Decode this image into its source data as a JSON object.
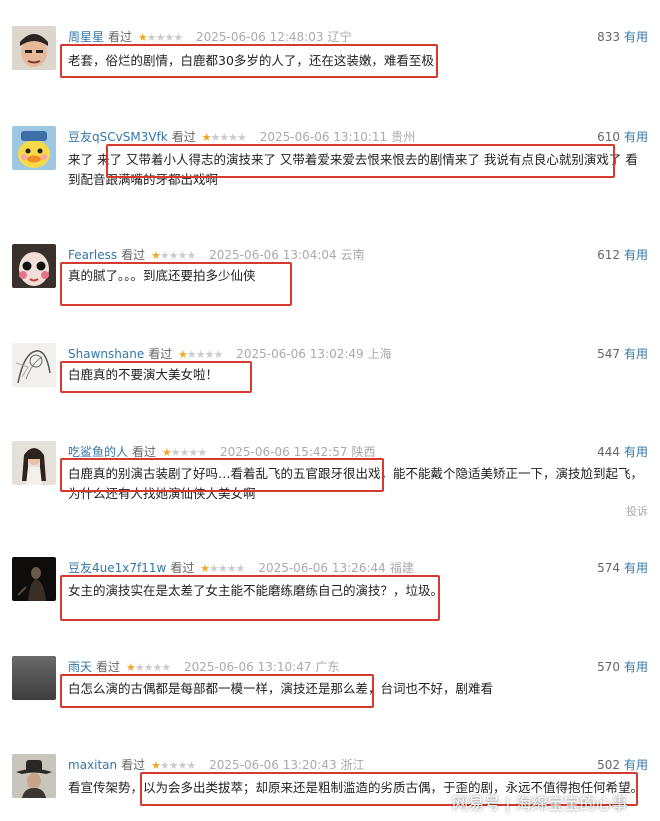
{
  "watched_label": "看过",
  "useful_label": "有用",
  "report_label": "投诉",
  "watermark": "网易号 | 海绵宝宝的心事",
  "reviews": [
    {
      "user": "周星星",
      "stars": 1,
      "date": "2025-06-06 12:48:03",
      "location": "辽宁",
      "votes": "833",
      "text": "老套，俗烂的剧情，白鹿都30多岁的人了，还在这装嫩，难看至极！",
      "avatar": "person-photo"
    },
    {
      "user": "豆友qSCvSM3Vfk",
      "stars": 1,
      "date": "2025-06-06 13:10:11",
      "location": "贵州",
      "votes": "610",
      "text": "来了 来了 又带着小人得志的演技来了 又带着爱来爱去恨来恨去的剧情来了 我说有点良心就别演戏了 看到配音跟满嘴的牙都出戏啊",
      "avatar": "duck"
    },
    {
      "user": "Fearless",
      "stars": 1,
      "date": "2025-06-06 13:04:04",
      "location": "云南",
      "votes": "612",
      "text": "真的腻了。。。到底还要拍多少仙侠",
      "avatar": "doll-face"
    },
    {
      "user": "Shawnshane",
      "stars": 1,
      "date": "2025-06-06 13:02:49",
      "location": "上海",
      "votes": "547",
      "text": "白鹿真的不要演大美女啦！",
      "avatar": "sketch"
    },
    {
      "user": "吃鲨鱼的人",
      "stars": 1,
      "date": "2025-06-06 15:42:57",
      "location": "陕西",
      "votes": "444",
      "text": "白鹿真的别演古装剧了好吗…看着乱飞的五官跟牙很出戏，能不能戴个隐适美矫正一下，演技尬到起飞，为什么还有人找她演仙侠大美女啊",
      "avatar": "girl-photo"
    },
    {
      "user": "豆友4ue1x7f11w",
      "stars": 1,
      "date": "2025-06-06 13:26:44",
      "location": "福建",
      "votes": "574",
      "text": "女主的演技实在是太差了女主能不能磨练磨练自己的演技？，垃圾。",
      "avatar": "dark-figure"
    },
    {
      "user": "雨天",
      "stars": 1,
      "date": "2025-06-06 13:10:47",
      "location": "广东",
      "votes": "570",
      "text": "白怎么演的古偶都是每部都一模一样，演技还是那么差，台词也不好，剧难看",
      "avatar": "gray"
    },
    {
      "user": "maxitan",
      "stars": 1,
      "date": "2025-06-06 13:20:43",
      "location": "浙江",
      "votes": "502",
      "text": "看宣传架势，以为会多出类拔萃；却原来还是粗制滥造的劣质古偶，于歪的剧，永远不值得抱任何希望。",
      "avatar": "cowboy"
    }
  ]
}
